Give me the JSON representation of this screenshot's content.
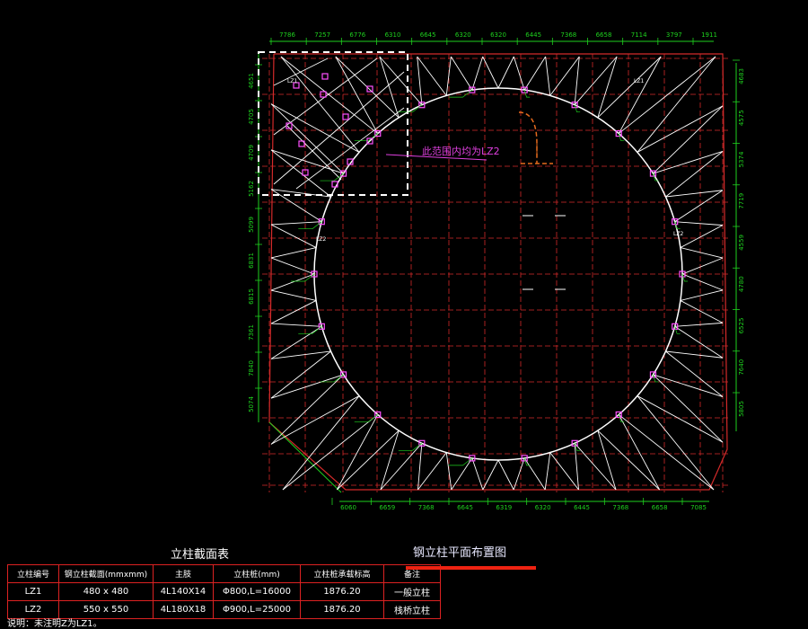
{
  "drawing": {
    "plan_title": "钢立柱平面布置图",
    "callout_note": "此范围内均为LZ2",
    "colors": {
      "background": "#000000",
      "grid": "#d42a2a",
      "dimension": "#1ed11e",
      "truss": "#ffffff",
      "node_marker": "#ff4fff",
      "callout": "#e040e0",
      "boundary_dashed": "#ffffff"
    },
    "top_dimensions": [
      "7786",
      "7257",
      "6776",
      "6310",
      "6645",
      "6320",
      "6320",
      "6445",
      "7368",
      "6658",
      "7114",
      "3797",
      "1911"
    ],
    "bottom_dimensions": [
      "6060",
      "6659",
      "7368",
      "6645",
      "6319",
      "6320",
      "6445",
      "7368",
      "6658",
      "7085"
    ],
    "left_dimensions": [
      "4651",
      "4705",
      "4709",
      "5162",
      "5099",
      "6831",
      "6815",
      "7361",
      "7840",
      "5074"
    ],
    "right_dimensions": [
      "4683",
      "4575",
      "5374",
      "7719",
      "4559",
      "4780",
      "6525",
      "7640",
      "5805"
    ],
    "node_labels": [
      "LZ1",
      "LZ1",
      "LZ2",
      "LZ2"
    ]
  },
  "table": {
    "title": "立柱截面表",
    "headers": [
      "立柱编号",
      "钢立柱截面(mmxmm)",
      "主肢",
      "立柱桩(mm)",
      "立柱桩承载标高",
      "备注"
    ],
    "rows": [
      [
        "LZ1",
        "480 x 480",
        "4L140X14",
        "Φ800,L=16000",
        "1876.20",
        "一般立柱"
      ],
      [
        "LZ2",
        "550 x 550",
        "4L180X18",
        "Φ900,L=25000",
        "1876.20",
        "栈桥立柱"
      ]
    ],
    "note": "说明：未注明Z为LZ1。"
  }
}
